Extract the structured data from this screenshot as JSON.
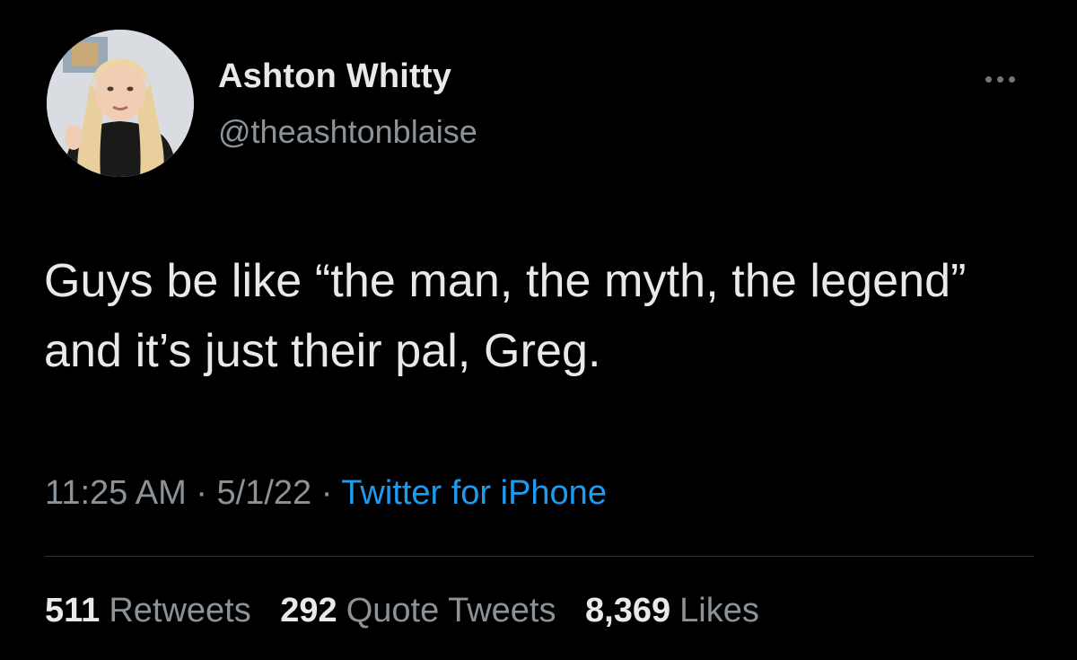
{
  "user": {
    "display_name": "Ashton Whitty",
    "handle": "@theashtonblaise",
    "avatar_icon": "profile-photo"
  },
  "tweet": {
    "text": "Guys be like “the man, the myth, the legend” and it’s just their pal, Greg.",
    "time": "11:25 AM",
    "date": "5/1/22",
    "separator": "·",
    "source": "Twitter for iPhone"
  },
  "stats": {
    "retweets_count": "511",
    "retweets_label": "Retweets",
    "quotes_count": "292",
    "quotes_label": "Quote Tweets",
    "likes_count": "8,369",
    "likes_label": "Likes"
  },
  "colors": {
    "background": "#000000",
    "text": "#e7e9ea",
    "secondary_text": "#8b9399",
    "link": "#1d9bf0",
    "divider": "#2f3336"
  },
  "icons": {
    "more": "more-horizontal-icon"
  }
}
